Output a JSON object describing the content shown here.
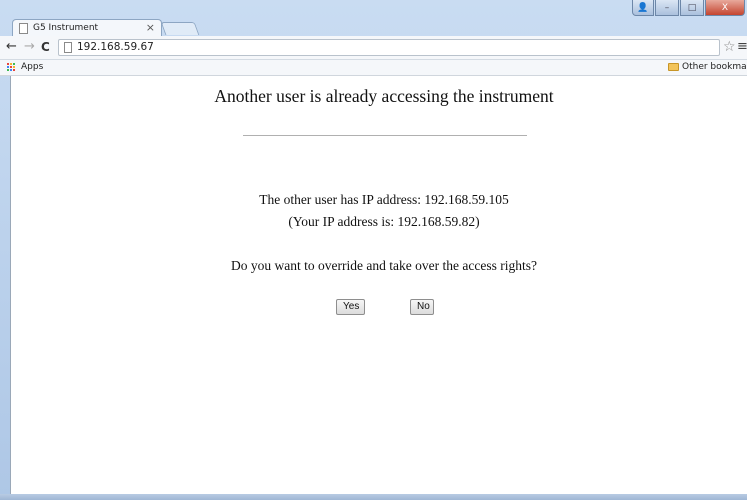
{
  "browser": {
    "tab_title": "G5 Instrument",
    "tab_close": "×",
    "url": "192.168.59.67",
    "bookmarks": {
      "apps_label": "Apps",
      "other_label": "Other bookmarks"
    },
    "controls": {
      "user": "👤",
      "minimize": "–",
      "maximize": "□",
      "close": "X"
    },
    "icons": {
      "back": "←",
      "forward": "→",
      "reload": "C",
      "star": "☆",
      "menu": "≡"
    },
    "colors": {
      "frame": "#aec7e6",
      "apps_grid": [
        "#e8453c",
        "#f3b62c",
        "#3cba54",
        "#4285f4",
        "#e8453c",
        "#f3b62c",
        "#3cba54",
        "#4285f4",
        "#e8453c"
      ]
    }
  },
  "page": {
    "heading": "Another user is already accessing the instrument",
    "other_user_line": "The other user has IP address: 192.168.59.105",
    "your_ip_line": "(Your IP address is: 192.168.59.82)",
    "question": "Do you want to override and take over the access rights?",
    "yes_label": "Yes",
    "no_label": "No"
  }
}
